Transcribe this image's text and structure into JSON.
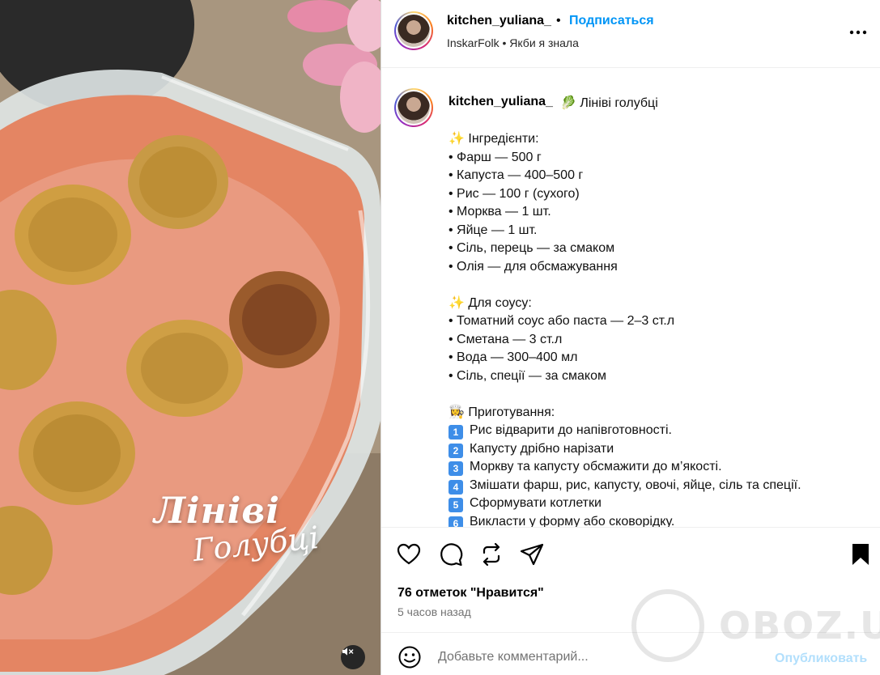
{
  "post": {
    "username": "kitchen_yuliana_",
    "separator": "•",
    "follow_label": "Подписаться",
    "music": "InskarFolk • Якби я знала",
    "more_icon": "more-horizontal-icon"
  },
  "media": {
    "overlay_title": "Лініві",
    "overlay_subtitle": "Голубці",
    "mute_icon": "speaker-muted-icon"
  },
  "caption": {
    "username": "kitchen_yuliana_",
    "title_emoji": "🥬",
    "title": "Лініві голубці",
    "lines": [
      {
        "type": "text",
        "text": "✨ Інгредієнти:"
      },
      {
        "type": "text",
        "text": "• Фарш — 500 г"
      },
      {
        "type": "text",
        "text": "• Капуста — 400–500 г"
      },
      {
        "type": "text",
        "text": "• Рис — 100 г (сухого)"
      },
      {
        "type": "text",
        "text": "• Морква — 1 шт."
      },
      {
        "type": "text",
        "text": "• Яйце — 1 шт."
      },
      {
        "type": "text",
        "text": "• Сіль, перець — за смаком"
      },
      {
        "type": "text",
        "text": "• Олія — для обсмажування"
      },
      {
        "type": "gap",
        "text": ""
      },
      {
        "type": "text",
        "text": "✨ Для соусу:"
      },
      {
        "type": "text",
        "text": "• Томатний соус або паста — 2–3 ст.л"
      },
      {
        "type": "text",
        "text": "• Сметана — 3 ст.л"
      },
      {
        "type": "text",
        "text": "• Вода — 300–400 мл"
      },
      {
        "type": "text",
        "text": "• Сіль, спеції — за смаком"
      },
      {
        "type": "gap",
        "text": ""
      },
      {
        "type": "text",
        "text": "👩‍🍳 Приготування:"
      },
      {
        "type": "step",
        "num": "1",
        "text": "Рис відварити до напівготовності."
      },
      {
        "type": "step",
        "num": "2",
        "text": "Капусту дрібно нарізати"
      },
      {
        "type": "step",
        "num": "3",
        "text": "Моркву та капусту обсмажити до м’якості."
      },
      {
        "type": "step",
        "num": "4",
        "text": "Змішати фарш, рис, капусту, овочі, яйце, сіль та спеції."
      },
      {
        "type": "step",
        "num": "5",
        "text": "Сформувати котлетки"
      },
      {
        "type": "step",
        "num": "6",
        "text": "Викласти у форму або сковорідку."
      }
    ]
  },
  "actions": {
    "icons": [
      "heart-icon",
      "comment-icon",
      "repost-icon",
      "share-icon",
      "bookmark-icon"
    ],
    "likes": "76 отметок \"Нравится\"",
    "time": "5 часов назад"
  },
  "comment": {
    "emoji_icon": "emoji-icon",
    "placeholder": "Добавьте комментарий...",
    "publish_label": "Опубликовать"
  },
  "watermark": {
    "text": "OBOZ.UA"
  },
  "colors": {
    "accent": "#0095f6",
    "publish_disabled": "#b2dffc",
    "muted_text": "#737373"
  }
}
